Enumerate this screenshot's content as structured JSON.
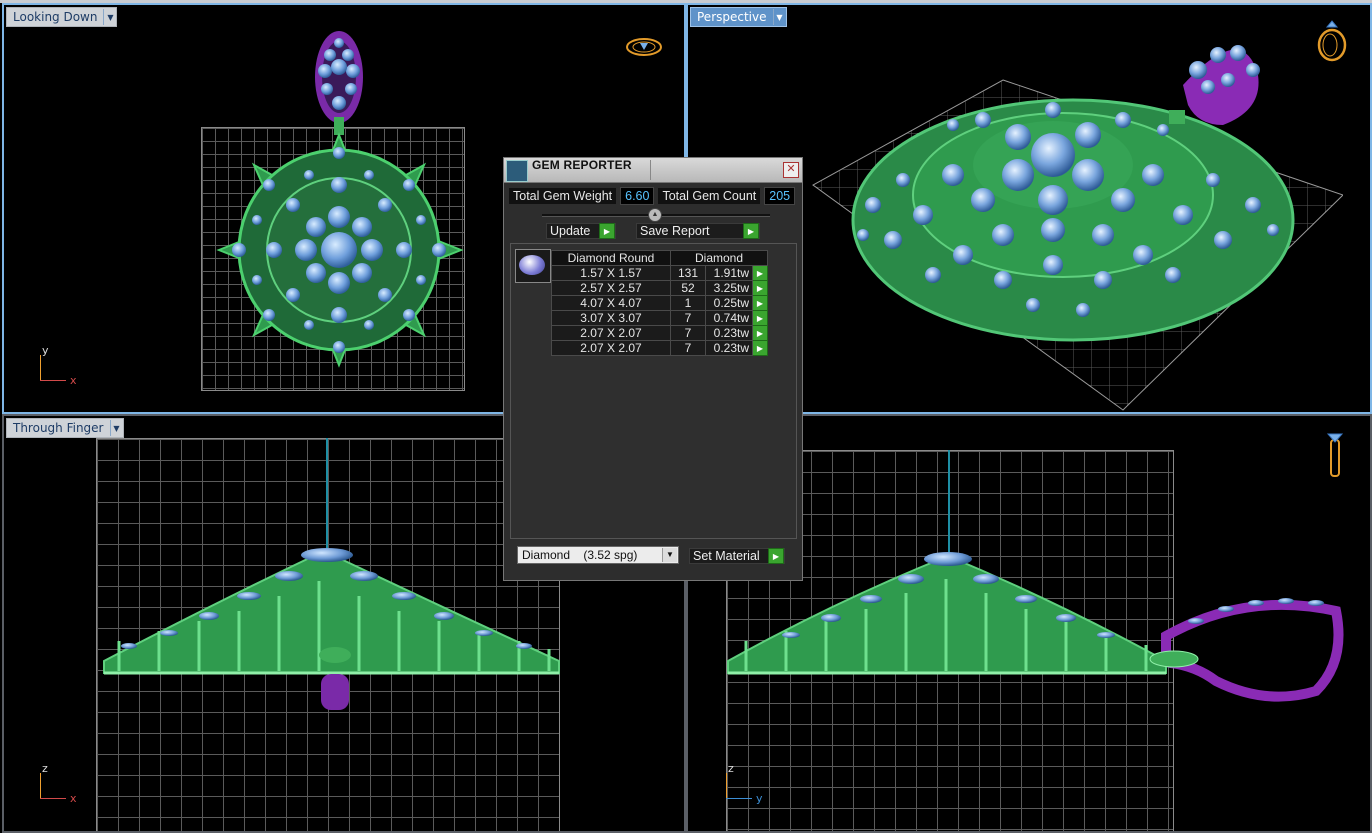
{
  "viewports": {
    "top_left": {
      "label": "Looking Down",
      "axis_v": "y",
      "axis_h": "x"
    },
    "top_right": {
      "label": "Perspective"
    },
    "bottom_left": {
      "label": "Through Finger",
      "axis_v": "z",
      "axis_h": "x"
    },
    "bottom_right": {
      "axis_v": "z",
      "axis_h": "y"
    }
  },
  "dialog": {
    "title": "GEM REPORTER",
    "close_glyph": "✕",
    "total_weight_label": "Total Gem Weight",
    "total_weight_value": "6.60",
    "total_count_label": "Total Gem Count",
    "total_count_value": "205",
    "update_label": "Update",
    "save_report_label": "Save Report",
    "table": {
      "headers": [
        "Diamond Round",
        "Diamond"
      ],
      "rows": [
        {
          "size": "1.57 X 1.57",
          "count": "131",
          "weight": "1.91tw"
        },
        {
          "size": "2.57 X 2.57",
          "count": "52",
          "weight": "3.25tw"
        },
        {
          "size": "4.07 X 4.07",
          "count": "1",
          "weight": "0.25tw"
        },
        {
          "size": "3.07 X 3.07",
          "count": "7",
          "weight": "0.74tw"
        },
        {
          "size": "2.07 X 2.07",
          "count": "7",
          "weight": "0.23tw"
        },
        {
          "size": "2.07 X 2.07",
          "count": "7",
          "weight": "0.23tw"
        }
      ]
    },
    "material_select": "Diamond    (3.52 spg)",
    "set_material_label": "Set Material"
  },
  "colors": {
    "metal_green": "#3fae5a",
    "gem_blue": "#7fa9e0",
    "bail_purple": "#8a2bb5",
    "active_border": "#7fb6e6",
    "go_green": "#3aa52f"
  },
  "icons": [
    "top-view-ring-icon",
    "perspective-ring-icon",
    "front-view-ring-icon",
    "gem-thumbnail-icon"
  ]
}
